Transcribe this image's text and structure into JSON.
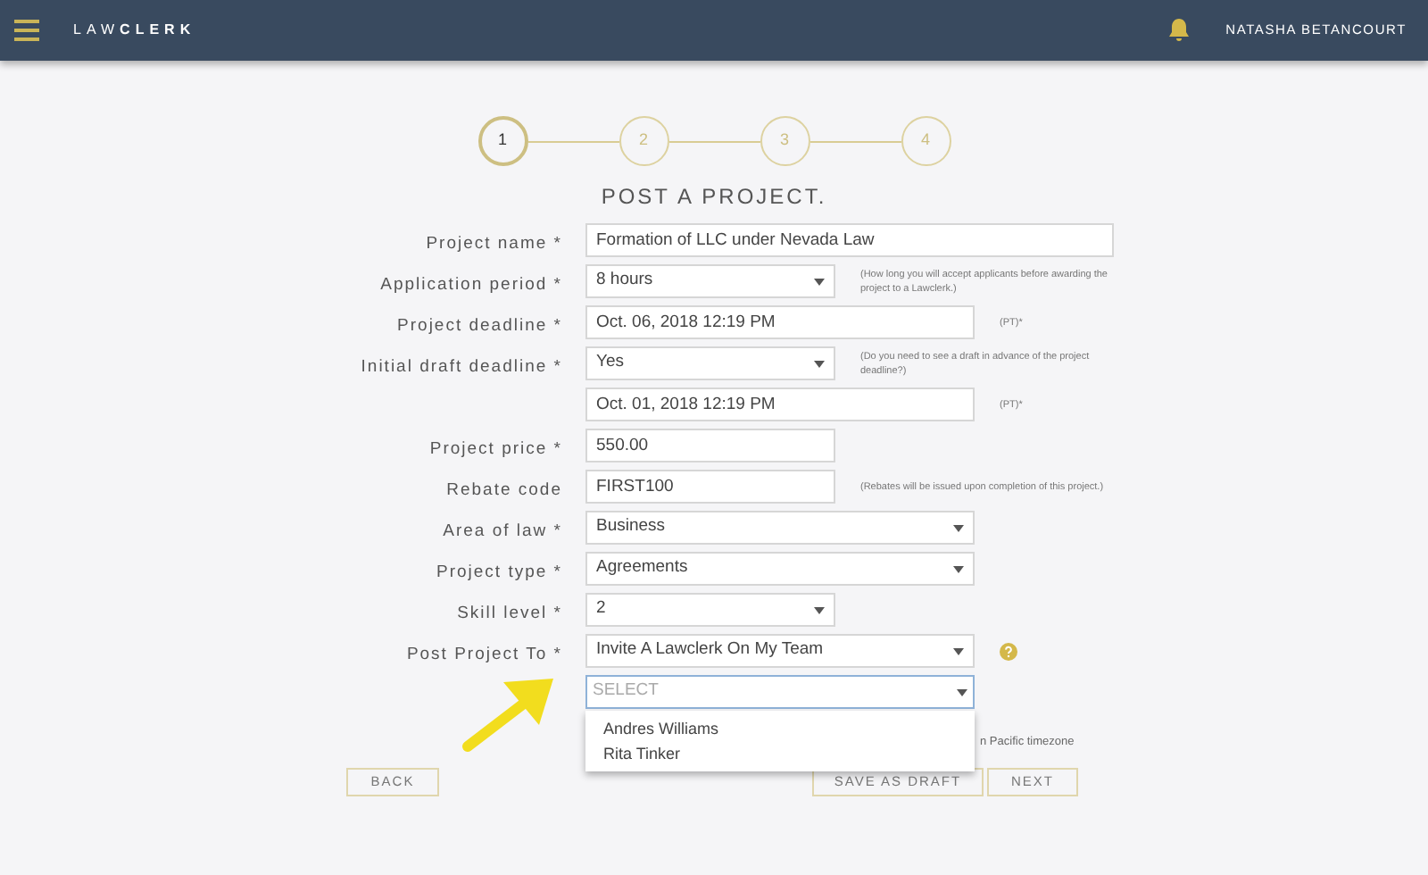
{
  "header": {
    "logo_light": "LAW",
    "logo_bold": "CLERK",
    "user": "NATASHA BETANCOURT"
  },
  "steps": [
    {
      "label": "1",
      "selected": true
    },
    {
      "label": "2",
      "selected": false
    },
    {
      "label": "3",
      "selected": false
    },
    {
      "label": "4",
      "selected": false
    }
  ],
  "title": "POST A PROJECT.",
  "rows": [
    {
      "label": "Project name *",
      "kind": "text",
      "value": "Formation of LLC under Nevada Law"
    },
    {
      "label": "Application period *",
      "kind": "select",
      "value": "8 hours",
      "note": "(How long you will accept applicants before awarding the project to a Lawclerk.)"
    },
    {
      "label": "Project deadline *",
      "kind": "text",
      "value": "Oct. 06, 2018 12:19 PM",
      "note": "(PT)*"
    },
    {
      "label": "Initial draft deadline *",
      "kind": "select",
      "value": "Yes",
      "note": "(Do you need to see a draft in advance of the project deadline?)"
    },
    {
      "kind": "text",
      "value": "Oct. 01, 2018 12:19 PM",
      "note": "(PT)*"
    },
    {
      "label": "Project price *",
      "kind": "text",
      "value": "550.00"
    },
    {
      "label": "Rebate code",
      "kind": "text",
      "value": "FIRST100",
      "note": "(Rebates will be issued upon completion of this project.)"
    },
    {
      "label": "Area of law *",
      "kind": "select",
      "value": "Business"
    },
    {
      "label": "Project type *",
      "kind": "select",
      "value": "Agreements"
    },
    {
      "label": "Skill level *",
      "kind": "select",
      "value": "2"
    },
    {
      "label": "Post Project To *",
      "kind": "select",
      "value": "Invite A Lawclerk On My Team",
      "help": true
    }
  ],
  "team_select": {
    "placeholder": "SELECT",
    "focused": true,
    "expanded": true,
    "options": [
      "Andres Williams",
      "Rita Tinker"
    ]
  },
  "timezone_note": "n Pacific timezone",
  "buttons": {
    "back": "BACK",
    "save": "SAVE AS DRAFT",
    "next": "NEXT"
  }
}
